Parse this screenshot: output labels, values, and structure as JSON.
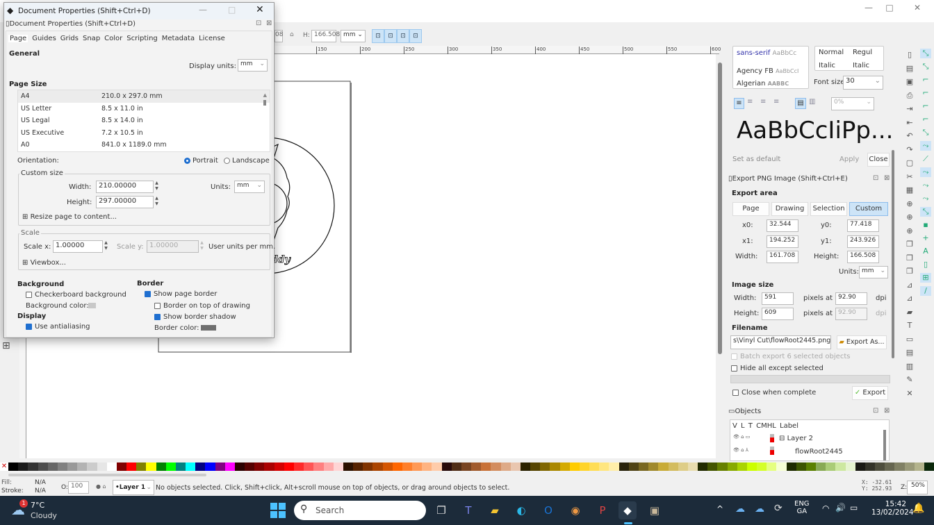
{
  "main_window": {
    "controls": {
      "minimize": "—",
      "maximize": "□",
      "close": "✕"
    }
  },
  "toolbar": {
    "h_label": "H:",
    "h_value": "166.508",
    "units": "mm",
    "partial_value": "08"
  },
  "ruler": {
    "ticks": [
      "150",
      "200",
      "250",
      "300",
      "350",
      "400",
      "450",
      "500",
      "550",
      "600"
    ]
  },
  "dialog": {
    "window_title": "Document Properties (Shift+Ctrl+D)",
    "dock_title": "Document Properties (Shift+Ctrl+D)",
    "tabs": [
      "Page",
      "Guides",
      "Grids",
      "Snap",
      "Color",
      "Scripting",
      "Metadata",
      "License"
    ],
    "general_heading": "General",
    "display_units_label": "Display units:",
    "display_units": "mm",
    "page_size_heading": "Page Size",
    "page_sizes": [
      {
        "name": "A4",
        "size": "210.0 x 297.0 mm"
      },
      {
        "name": "US Letter",
        "size": "8.5 x 11.0 in"
      },
      {
        "name": "US Legal",
        "size": "8.5 x 14.0 in"
      },
      {
        "name": "US Executive",
        "size": "7.2 x 10.5 in"
      },
      {
        "name": "A0",
        "size": "841.0 x 1189.0 mm"
      }
    ],
    "orientation_label": "Orientation:",
    "portrait": "Portrait",
    "landscape": "Landscape",
    "orientation_selected": "Portrait",
    "custom_size_label": "Custom size",
    "width_label": "Width:",
    "width_value": "210.00000",
    "height_label": "Height:",
    "height_value": "297.00000",
    "units_label": "Units:",
    "units_value": "mm",
    "resize_label": "Resize page to content...",
    "scale_label": "Scale",
    "scale_x_label": "Scale x:",
    "scale_x_value": "1.00000",
    "scale_y_label": "Scale y:",
    "scale_y_value": "1.00000",
    "user_units": "User units per mm.",
    "viewbox_label": "Viewbox...",
    "background_heading": "Background",
    "checkerboard_label": "Checkerboard background",
    "checkerboard_checked": false,
    "bg_color_label": "Background color:",
    "bg_color": "#c8c8c8",
    "display_heading": "Display",
    "antialias_label": "Use antialiasing",
    "antialias_checked": true,
    "border_heading": "Border",
    "show_border_label": "Show page border",
    "show_border_checked": true,
    "border_top_label": "Border on top of drawing",
    "border_top_checked": false,
    "border_shadow_label": "Show border shadow",
    "border_shadow_checked": true,
    "border_color_label": "Border color:",
    "border_color": "#6e6e6e"
  },
  "text_panel": {
    "fonts": [
      {
        "name": "sans-serif",
        "sample": "AaBbCc"
      },
      {
        "name": "Agency FB",
        "sample": "AaBbCcI"
      },
      {
        "name": "Algerian",
        "sample": "AABBC"
      }
    ],
    "styles": [
      {
        "a": "Normal",
        "b": "Regul"
      },
      {
        "a": "Italic",
        "b": "Italic"
      }
    ],
    "font_size_label": "Font size",
    "font_size": "30",
    "spacing": "0%",
    "preview": "AaBbCcIiPp...",
    "set_default": "Set as default",
    "apply": "Apply",
    "close": "Close"
  },
  "export_panel": {
    "title": "Export PNG Image (Shift+Ctrl+E)",
    "area_heading": "Export area",
    "area_buttons": [
      "Page",
      "Drawing",
      "Selection",
      "Custom"
    ],
    "area_selected": "Custom",
    "x0_label": "x0:",
    "x0": "32.544",
    "y0_label": "y0:",
    "y0": "77.418",
    "x1_label": "x1:",
    "x1": "194.252",
    "y1_label": "y1:",
    "y1": "243.926",
    "width_label": "Width:",
    "width": "161.708",
    "height_label": "Height:",
    "height": "166.508",
    "units_label": "Units:",
    "units": "mm",
    "image_size_heading": "Image size",
    "img_width_label": "Width:",
    "img_width": "591",
    "img_height_label": "Height:",
    "img_height": "609",
    "pixels_at": "pixels at",
    "dpi_x": "92.90",
    "dpi_y": "92.90",
    "dpi": "dpi",
    "filename_heading": "Filename",
    "filename": "s\\Vinyl Cut\\flowRoot2445.png",
    "export_as": "Export As...",
    "batch_label": "Batch export 6 selected objects",
    "hide_label": "Hide all except selected",
    "close_when_label": "Close when complete",
    "export_button": "Export"
  },
  "objects_panel": {
    "title": "Objects",
    "columns": [
      "V",
      "L",
      "T",
      "CM",
      "HL",
      "Label"
    ],
    "rows": [
      {
        "label": "Layer 2"
      },
      {
        "label": "flowRoot2445"
      }
    ]
  },
  "statusbar": {
    "fill_label": "Fill:",
    "fill_value": "N/A",
    "stroke_label": "Stroke:",
    "stroke_value": "N/A",
    "opacity_label": "O:",
    "opacity_value": "100",
    "layer": "•Layer 1",
    "message": "No objects selected. Click, Shift+click, Alt+scroll mouse on top of objects, or drag around objects to select.",
    "x_label": "X:",
    "x_value": "-32.61",
    "y_label": "Y:",
    "y_value": "252.93",
    "zoom_label": "Z:",
    "zoom_value": "50%"
  },
  "taskbar": {
    "weather_temp": "7°C",
    "weather_desc": "Cloudy",
    "weather_badge": "1",
    "search_placeholder": "Search",
    "lang_top": "ENG",
    "lang_bottom": "GA",
    "time": "15:42",
    "date": "13/02/2024"
  },
  "palette_colors": [
    "#000",
    "#1a1a1a",
    "#333",
    "#4d4d4d",
    "#666",
    "#808080",
    "#999",
    "#b3b3b3",
    "#ccc",
    "#e6e6e6",
    "#fff",
    "#800000",
    "#f00",
    "#808000",
    "#ff0",
    "#008000",
    "#0f0",
    "#008080",
    "#0ff",
    "#000080",
    "#00f",
    "#800080",
    "#f0f",
    "#2b0000",
    "#550000",
    "#800000",
    "#aa0000",
    "#d40000",
    "#f00",
    "#ff2a2a",
    "#f55",
    "#ff8080",
    "#faa",
    "#ffd5d5",
    "#2b1100",
    "#552200",
    "#803300",
    "#aa4400",
    "#d45500",
    "#f60",
    "#ff7f2a",
    "#f95",
    "#ffb380",
    "#fca",
    "#280b0b",
    "#502d16",
    "#784421",
    "#a05a2c",
    "#c87137",
    "#d38d5f",
    "#deaa87",
    "#e9c6af",
    "#2b2200",
    "#554400",
    "#806600",
    "#aa8800",
    "#d4aa00",
    "#fc0",
    "#ffd42a",
    "#fd5",
    "#ffe680",
    "#fea",
    "#28220b",
    "#504416",
    "#786721",
    "#a0892c",
    "#c8ab37",
    "#d3bc5f",
    "#decd87",
    "#e9ddaf",
    "#222b00",
    "#445500",
    "#668000",
    "#88aa00",
    "#aad400",
    "#cf0",
    "#d4ff2a",
    "#e5ff80",
    "#f6ffd5",
    "#1e2b00",
    "#3c5500",
    "#5a8000",
    "#88aa55",
    "#aacc77",
    "#cde8a0",
    "#e6f4d0",
    "#1a1a14",
    "#333328",
    "#4d4d3c",
    "#666650",
    "#808064",
    "#999978",
    "#b3b38c",
    "#0b280b"
  ]
}
